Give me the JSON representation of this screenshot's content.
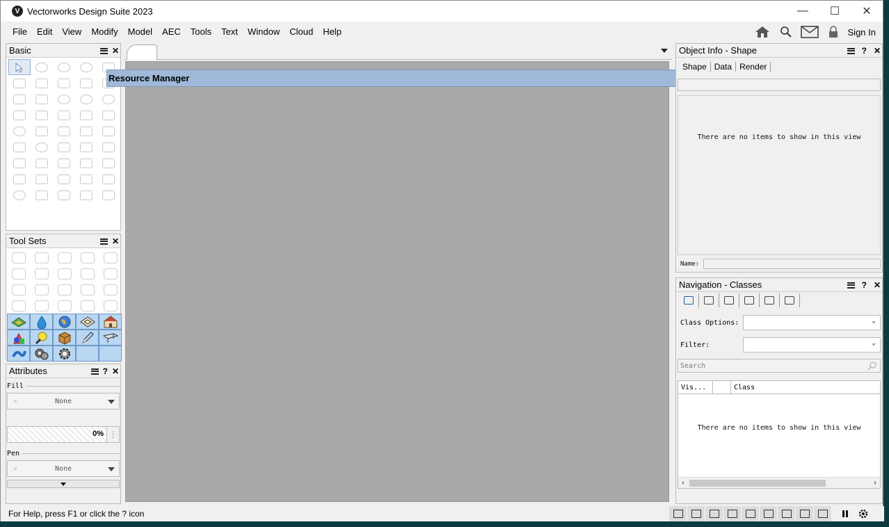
{
  "window": {
    "title": "Vectorworks Design Suite 2023",
    "app_icon": "V",
    "controls": {
      "minimize": "—",
      "maximize": "☐",
      "close": "✕"
    }
  },
  "menu": {
    "items": [
      "File",
      "Edit",
      "View",
      "Modify",
      "Model",
      "AEC",
      "Tools",
      "Text",
      "Window",
      "Cloud",
      "Help"
    ],
    "right": {
      "home_icon": "home-icon",
      "search_icon": "search-icon",
      "mail_icon": "mail-icon",
      "lock_icon": "lock-icon",
      "sign_in": "Sign In"
    }
  },
  "basic_palette": {
    "title": "Basic",
    "menu_icon": "≡",
    "close": "✕"
  },
  "toolsets_palette": {
    "title": "Tool Sets",
    "close": "✕"
  },
  "attributes_palette": {
    "title": "Attributes",
    "help": "?",
    "close": "✕",
    "fill_label": "Fill",
    "fill_value": "None",
    "opacity": "0%",
    "pen_label": "Pen",
    "pen_value": "None"
  },
  "resource_manager": {
    "title": "Resource Manager",
    "help": "?",
    "pin": "⊣",
    "close": "✕"
  },
  "object_info": {
    "title": "Object Info - Shape",
    "help": "?",
    "close": "✕",
    "tabs": [
      "Shape",
      "Data",
      "Render"
    ],
    "empty_text": "There are no items to show in this view",
    "name_label": "Name:"
  },
  "navigation": {
    "title": "Navigation - Classes",
    "help": "?",
    "close": "✕",
    "class_options_label": "Class Options:",
    "filter_label": "Filter:",
    "search_placeholder": "Search",
    "columns": [
      "Vis...",
      "",
      "Class"
    ],
    "empty_text": "There are no items to show in this view"
  },
  "status_bar": {
    "help_text": "For Help, press F1 or click the ? icon"
  },
  "colors": {
    "canvas": "#a9a9a9",
    "resource_manager_bar": "#9fb9d9",
    "active_toolset": "#b9d7f2"
  }
}
